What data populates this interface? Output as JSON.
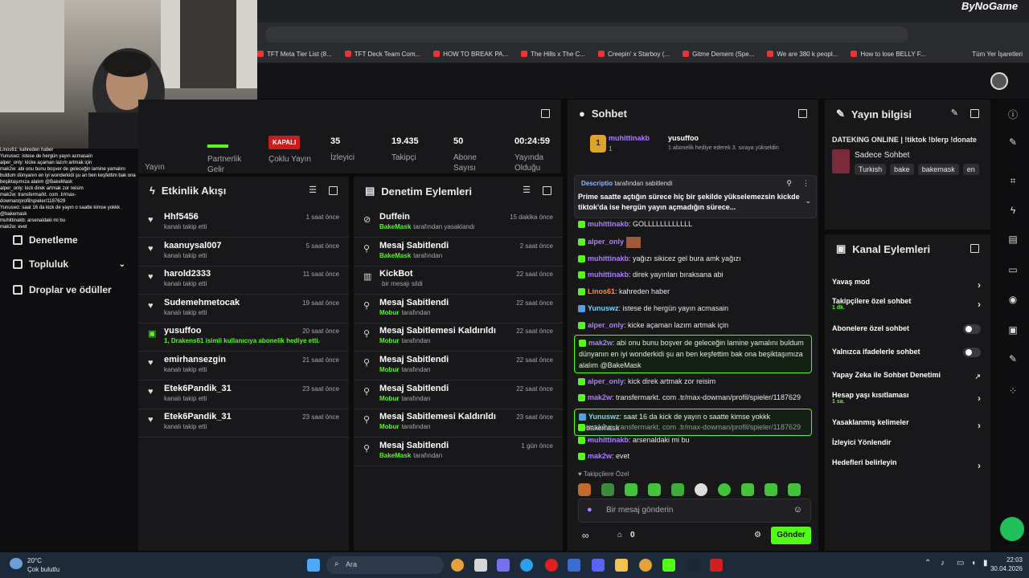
{
  "brand": "ByNoGame",
  "bookmarks": [
    "TFT Meta Tier List (8...",
    "TFT Deck Team Com...",
    "HOW TO BREAK PA...",
    "The Hills x The C...",
    "Creepin' x Starboy (...",
    "Gitme Demem (Spe...",
    "We are 380 k peopl...",
    "How to lose BELLY F...",
    "Tüm Yer İşaretleri"
  ],
  "left_nav": {
    "topluluk": "Topluluk",
    "droplar": "Droplar ve ödüller",
    "denetleme": "Denetleme"
  },
  "overlay_chat": [
    "Linos61: kahreden haber",
    "Yunuswz: istese de hergün yayın acmasain",
    "alper_only: kicke açaman lazım artmak için",
    "mak2w: abi onu bunu boşver de geleceğin lamine yamalını buldum dünyanın en iyi wonderkidi şu an ben keşfettim bak ona beşiktaşımıza alalım @BakeMask",
    "alper_only: kick direk artmak zor reisim",
    "mak2w: transfermarkt. com .tr/max-dowman/profil/spieler/1187629",
    "Yunuswz: saat 16 da kick de yayın o saatte kimse yokkk @bakemask",
    "muhittinakb: arsenaldaki mi bu",
    "mak2w: evet"
  ],
  "stats": {
    "yayin_label": "Yayın",
    "partner_label": "Partnerlik Gelir",
    "kapali_badge": "KAPALI",
    "multistream_label": "Çoklu Yayın",
    "viewers": "35",
    "viewers_label": "İzleyici",
    "followers": "19.435",
    "followers_label": "Takipçi",
    "subs": "50",
    "subs_label": "Abone Sayısı",
    "uptime": "00:24:59",
    "uptime_label": "Yayında Olduğu"
  },
  "activity": {
    "title": "Etkinlik Akışı",
    "items": [
      {
        "name": "Hhf5456",
        "sub": "kanalı takip etti",
        "time": "1 saat önce"
      },
      {
        "name": "kaanuysal007",
        "sub": "kanalı takip etti",
        "time": "5 saat önce"
      },
      {
        "name": "harold2333",
        "sub": "kanalı takip etti",
        "time": "11 saat önce"
      },
      {
        "name": "Sudemehmetocak",
        "sub": "kanalı takip etti",
        "time": "19 saat önce"
      },
      {
        "name": "yusuffoo",
        "sub": "1, Drakens61 isimli kullanıcıya abonelik hediye etti.",
        "time": "20 saat önce"
      },
      {
        "name": "emirhansezgin",
        "sub": "kanalı takip etti",
        "time": "21 saat önce"
      },
      {
        "name": "Etek6Pandik_31",
        "sub": "kanalı takip etti",
        "time": "23 saat önce"
      },
      {
        "name": "Etek6Pandik_31",
        "sub": "kanalı takip etti",
        "time": "23 saat önce"
      }
    ]
  },
  "moderation": {
    "title": "Denetim Eylemleri",
    "items": [
      {
        "name": "Duffein",
        "sub_user": "BakeMask",
        "sub": "tarafından yasaklandı",
        "time": "15 dakika önce"
      },
      {
        "name": "Mesaj Sabitlendi",
        "sub_user": "BakeMask",
        "sub": "tarafından",
        "time": "2 saat önce"
      },
      {
        "name": "KickBot",
        "sub_user": "",
        "sub": "bir mesajı sildi",
        "time": "22 saat önce"
      },
      {
        "name": "Mesaj Sabitlendi",
        "sub_user": "Mobur",
        "sub": "tarafından",
        "time": "22 saat önce"
      },
      {
        "name": "Mesaj Sabitlemesi Kaldırıldı",
        "sub_user": "Mobur",
        "sub": "tarafından",
        "time": "22 saat önce"
      },
      {
        "name": "Mesaj Sabitlendi",
        "sub_user": "Mobur",
        "sub": "tarafından",
        "time": "22 saat önce"
      },
      {
        "name": "Mesaj Sabitlendi",
        "sub_user": "Mobur",
        "sub": "tarafından",
        "time": "22 saat önce"
      },
      {
        "name": "Mesaj Sabitlemesi Kaldırıldı",
        "sub_user": "Mobur",
        "sub": "tarafından",
        "time": "23 saat önce"
      },
      {
        "name": "Mesaj Sabitlendi",
        "sub_user": "BakeMask",
        "sub": "tarafından",
        "time": "1 gün önce"
      }
    ]
  },
  "chat": {
    "title": "Sohbet",
    "gift_user": "muhittinakb",
    "gift_count": "1",
    "gift_target": "yusuffoo",
    "gift_text": "1 abonelik hediye ederek 3. sıraya yükseldin",
    "pinned_by": "Descriptio",
    "pinned_by_suffix": "tarafından sabitlendi",
    "pinned_text": "Prime saatte açtığın sürece hiç bir şekilde yükselemezsin kickde tiktok'da ise hergün yayın açmadığın sürece...",
    "messages": [
      {
        "user": "muhittinakb",
        "text": "GOLLLLLLLLLLLL",
        "color": "#b07cff"
      },
      {
        "user": "alper_only",
        "text": "",
        "color": "#b07cff"
      },
      {
        "user": "muhittinakb",
        "text": "yağızı sikicez gel bura amk yağızı",
        "color": "#b07cff"
      },
      {
        "user": "muhittinakb",
        "text": "direk yayınları bıraksana abi",
        "color": "#b07cff"
      },
      {
        "user": "Linos61",
        "text": "kahreden haber",
        "color": "#ff8c3a"
      },
      {
        "user": "Yunuswz",
        "text": "istese de hergün yayın acmasain",
        "color": "#7dd3fc"
      },
      {
        "user": "alper_only",
        "text": "kicke açaman lazım artmak için",
        "color": "#b07cff"
      },
      {
        "user": "mak2w",
        "text": "abi onu bunu boşver de geleceğin lamine yamalını buldum dünyanın en iyi wonderkidi şu an ben keşfettim bak ona beşiktaşımıza alalım @BakeMask",
        "color": "#b07cff"
      },
      {
        "user": "alper_only",
        "text": "kick direk artmak zor reisim",
        "color": "#b07cff"
      },
      {
        "user": "mak2w",
        "text": "transfermarkt. com .tr/max-dowman/profil/spieler/1187629",
        "color": "#b07cff"
      },
      {
        "user": "Yunuswz",
        "text": "saat 16 da kick de yayın o saatte kimse yokkk @bakemask",
        "color": "#7dd3fc"
      },
      {
        "user": "mak2w",
        "text": "transfermarkt. com .tr/max-dowman/profil/spieler/1187629 isi...",
        "color": "#9a9aa0"
      },
      {
        "user": "muhittinakb",
        "text": "arsenaldaki mi bu",
        "color": "#b07cff"
      },
      {
        "user": "mak2w",
        "text": "evet",
        "color": "#b07cff"
      }
    ],
    "followers_only": "Takipçilere Özel",
    "placeholder": "Bir mesaj gönderin",
    "count": "0",
    "send_label": "Gönder"
  },
  "stream_info": {
    "title": "Yayın bilgisi",
    "stream_title": "DATEKING ONLINE | !tiktok !blerp !donate",
    "category": "Sadece Sohbet",
    "tags": [
      "Turkish",
      "bake",
      "bakemask",
      "en"
    ]
  },
  "channel_actions": {
    "title": "Kanal Eylemleri",
    "items": [
      {
        "label": "Yavaş mod",
        "sub": "",
        "control": "chevron"
      },
      {
        "label": "Takipçilere özel sohbet",
        "sub": "1 dk.",
        "control": "chevron"
      },
      {
        "label": "Abonelere özel sohbet",
        "sub": "",
        "control": "toggle"
      },
      {
        "label": "Yalnızca ifadelerle sohbet",
        "sub": "",
        "control": "toggle"
      },
      {
        "label": "Yapay Zeka ile Sohbet Denetimi",
        "sub": "",
        "control": "external"
      },
      {
        "label": "Hesap yaşı kısıtlaması",
        "sub": "1 sa.",
        "control": "chevron"
      },
      {
        "label": "Yasaklanmış kelimeler",
        "sub": "",
        "control": "chevron"
      },
      {
        "label": "İzleyici Yönlendir",
        "sub": "",
        "control": "none"
      },
      {
        "label": "Hedefleri belirleyin",
        "sub": "",
        "control": "chevron"
      }
    ]
  },
  "taskbar": {
    "temp": "20°C",
    "weather": "Çok bulutlu",
    "search_placeholder": "Ara",
    "time": "22:03",
    "date": "30.04.2026"
  }
}
